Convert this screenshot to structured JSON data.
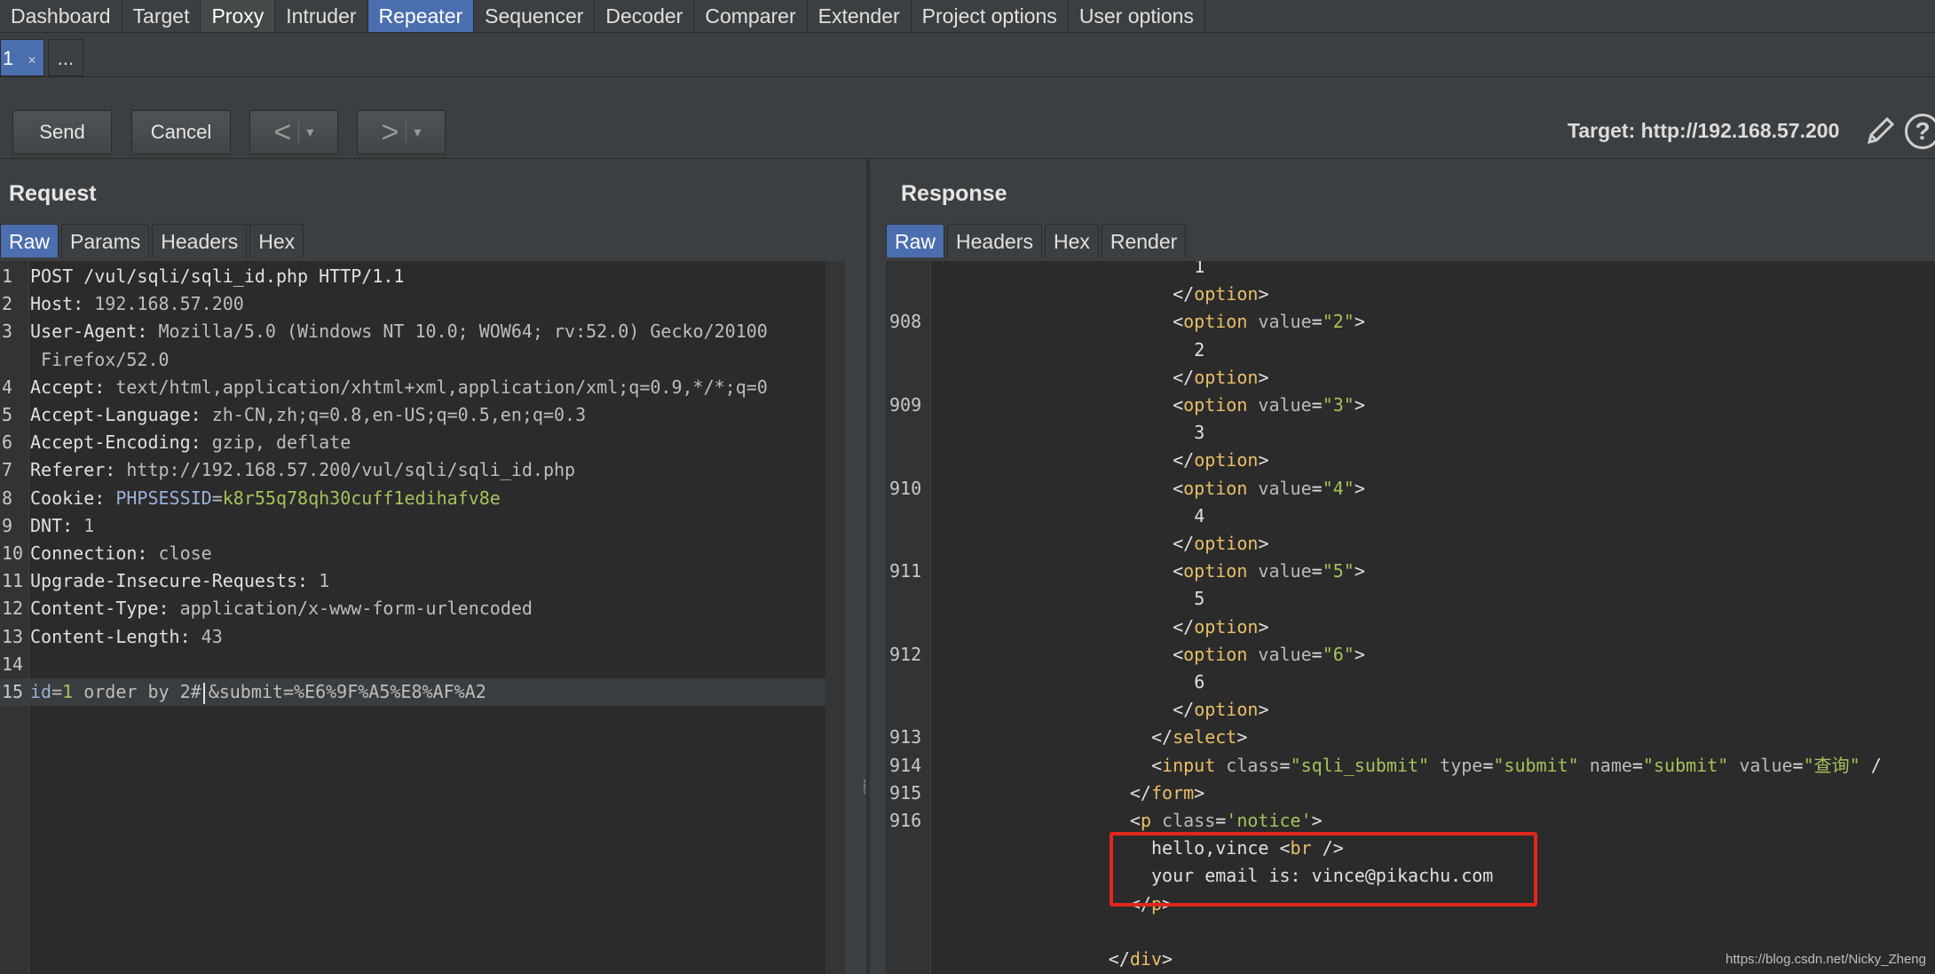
{
  "nav": {
    "tabs": [
      "Dashboard",
      "Target",
      "Proxy",
      "Intruder",
      "Repeater",
      "Sequencer",
      "Decoder",
      "Comparer",
      "Extender",
      "Project options",
      "User options"
    ],
    "active": "Repeater"
  },
  "repeater_tabs": {
    "tab1": "1",
    "close": "×",
    "new_tab": "..."
  },
  "toolbar": {
    "send": "Send",
    "cancel": "Cancel",
    "back_arrow": "<",
    "forward_arrow": ">",
    "dropdown": "▾",
    "target": "Target: http://192.168.57.200",
    "edit_icon": "pencil-icon",
    "help_icon": "help-icon",
    "help_glyph": "?"
  },
  "request": {
    "title": "Request",
    "tabs": [
      "Raw",
      "Params",
      "Headers",
      "Hex"
    ],
    "active_tab": "Raw",
    "lines": [
      {
        "n": "1",
        "t": "POST /vul/sqli/sqli_id.php HTTP/1.1"
      },
      {
        "n": "2",
        "k": "Host:",
        "v": " 192.168.57.200"
      },
      {
        "n": "3",
        "k": "User-Agent:",
        "v": " Mozilla/5.0 (Windows NT 10.0; WOW64; rv:52.0) Gecko/20100"
      },
      {
        "n": "",
        "w": " Firefox/52.0"
      },
      {
        "n": "4",
        "k": "Accept:",
        "v": " text/html,application/xhtml+xml,application/xml;q=0.9,*/*;q=0"
      },
      {
        "n": "5",
        "k": "Accept-Language:",
        "v": " zh-CN,zh;q=0.8,en-US;q=0.5,en;q=0.3"
      },
      {
        "n": "6",
        "k": "Accept-Encoding:",
        "v": " gzip, deflate"
      },
      {
        "n": "7",
        "k": "Referer:",
        "v": " http://192.168.57.200/vul/sqli/sqli_id.php"
      },
      {
        "n": "8",
        "k": "Cookie:",
        "ck": " PHPSESSID",
        "eq": "=",
        "cv": "k8r55q78qh30cuff1edihafv8e"
      },
      {
        "n": "9",
        "k": "DNT:",
        "v": " 1"
      },
      {
        "n": "10",
        "k": "Connection:",
        "v": " close"
      },
      {
        "n": "11",
        "k": "Upgrade-Insecure-Requests:",
        "v": " 1"
      },
      {
        "n": "12",
        "k": "Content-Type:",
        "v": " application/x-www-form-urlencoded"
      },
      {
        "n": "13",
        "k": "Content-Length:",
        "v": " 43"
      },
      {
        "n": "14",
        "t": ""
      },
      {
        "n": "15",
        "body": true,
        "pk": "id",
        "eq": "=",
        "pv": "1",
        "rest": " order by 2#",
        "after": "&submit=%E6%9F%A5%E8%AF%A2"
      }
    ]
  },
  "response": {
    "title": "Response",
    "tabs": [
      "Raw",
      "Headers",
      "Hex",
      "Render"
    ],
    "active_tab": "Raw",
    "lines": [
      {
        "n": "",
        "i": 12,
        "t": "1"
      },
      {
        "n": "",
        "i": 11,
        "open": "</",
        "tag": "option",
        "close": ">"
      },
      {
        "n": "908",
        "i": 11,
        "open": "<",
        "tag": "option",
        "attr": " value",
        "eq": "=",
        "val": "\"2\"",
        "close": ">"
      },
      {
        "n": "",
        "i": 12,
        "t": "2"
      },
      {
        "n": "",
        "i": 11,
        "open": "</",
        "tag": "option",
        "close": ">"
      },
      {
        "n": "909",
        "i": 11,
        "open": "<",
        "tag": "option",
        "attr": " value",
        "eq": "=",
        "val": "\"3\"",
        "close": ">"
      },
      {
        "n": "",
        "i": 12,
        "t": "3"
      },
      {
        "n": "",
        "i": 11,
        "open": "</",
        "tag": "option",
        "close": ">"
      },
      {
        "n": "910",
        "i": 11,
        "open": "<",
        "tag": "option",
        "attr": " value",
        "eq": "=",
        "val": "\"4\"",
        "close": ">"
      },
      {
        "n": "",
        "i": 12,
        "t": "4"
      },
      {
        "n": "",
        "i": 11,
        "open": "</",
        "tag": "option",
        "close": ">"
      },
      {
        "n": "911",
        "i": 11,
        "open": "<",
        "tag": "option",
        "attr": " value",
        "eq": "=",
        "val": "\"5\"",
        "close": ">"
      },
      {
        "n": "",
        "i": 12,
        "t": "5"
      },
      {
        "n": "",
        "i": 11,
        "open": "</",
        "tag": "option",
        "close": ">"
      },
      {
        "n": "912",
        "i": 11,
        "open": "<",
        "tag": "option",
        "attr": " value",
        "eq": "=",
        "val": "\"6\"",
        "close": ">"
      },
      {
        "n": "",
        "i": 12,
        "t": "6"
      },
      {
        "n": "",
        "i": 11,
        "open": "</",
        "tag": "option",
        "close": ">"
      },
      {
        "n": "913",
        "i": 10,
        "open": "</",
        "tag": "select",
        "close": ">"
      },
      {
        "n": "914",
        "i": 10,
        "input": true
      },
      {
        "n": "915",
        "i": 9,
        "open": "</",
        "tag": "form",
        "close": ">"
      },
      {
        "n": "916",
        "i": 9,
        "open": "<",
        "tag": "p",
        "attr": " class",
        "eq": "=",
        "val": "'notice'",
        "close": ">"
      },
      {
        "n": "",
        "i": 10,
        "t": "hello,vince ",
        "open2": "<",
        "tag2": "br",
        "close2": " />"
      },
      {
        "n": "",
        "i": 10,
        "t": "your email is: vince@pikachu.com"
      },
      {
        "n": "",
        "i": 9,
        "open": "</",
        "tag": "p",
        "close": ">"
      },
      {
        "n": "",
        "i": 0,
        "t": ""
      },
      {
        "n": "",
        "i": 8,
        "open": "</",
        "tag": "div",
        "close": ">"
      }
    ],
    "input_line": {
      "open": "<",
      "tag": "input",
      "a1": " class",
      "v1": "\"sqli_submit\"",
      "a2": " type",
      "v2": "\"submit\"",
      "a3": " name",
      "v3": "\"submit\"",
      "a4": " value",
      "v4": "\"查询\"",
      "tail": " /"
    }
  },
  "watermark": "https://blog.csdn.net/Nicky_Zheng"
}
